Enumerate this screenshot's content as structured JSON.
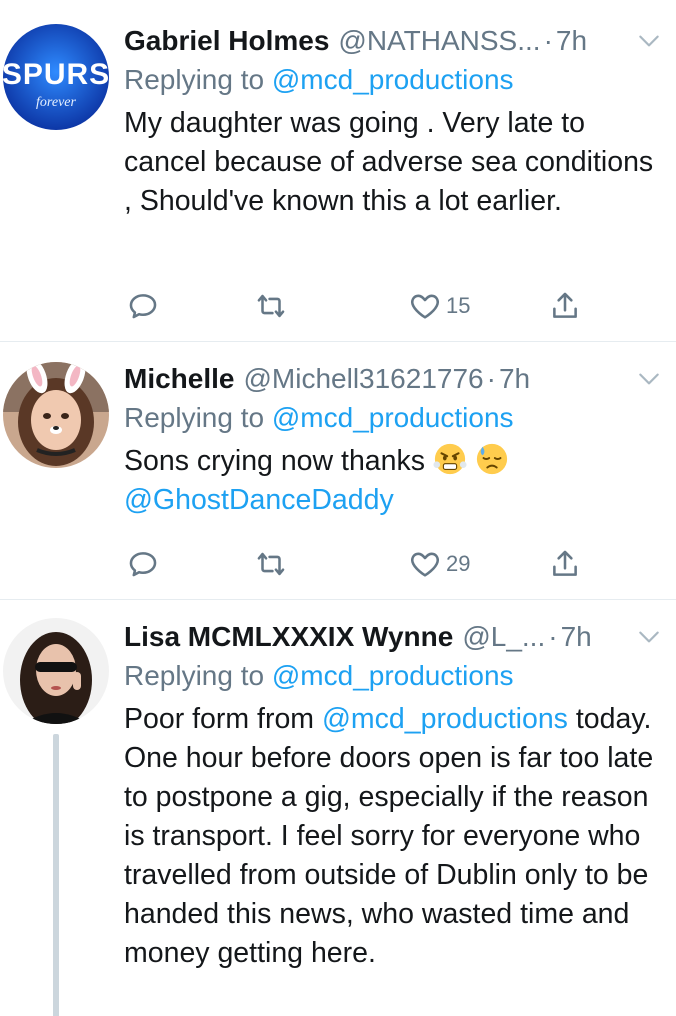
{
  "tweets": [
    {
      "name": "Gabriel Holmes",
      "handle": "@NATHANSS...",
      "time": "7h",
      "replying_prefix": "Replying to ",
      "replying_to": "@mcd_productions",
      "text": "My daughter was going . Very late to cancel because of adverse sea conditions , Should've known this a lot earlier.",
      "avatar_text": "SPURS",
      "avatar_subtext": "forever",
      "likes": "15"
    },
    {
      "name": "Michelle",
      "handle": "@Michell31621776",
      "time": "7h",
      "replying_prefix": "Replying to ",
      "replying_to": "@mcd_productions",
      "text": "Sons crying now thanks",
      "mention": "@GhostDanceDaddy",
      "likes": "29"
    },
    {
      "name": "Lisa MCMLXXXIX Wynne",
      "handle": "@L_...",
      "time": "7h",
      "replying_prefix": "Replying to ",
      "replying_to": "@mcd_productions",
      "text_prefix": "Poor form from ",
      "text_mention": "@mcd_productions",
      "text": " today. One hour before doors open is far too late to postpone a gig, especially if the reason is transport. I feel sorry for everyone who travelled from outside of Dublin only to be handed this news, who wasted time and money getting here."
    }
  ],
  "colors": {
    "accent": "#1da1f2",
    "secondary_text": "#657786",
    "divider": "#e6ecf0"
  },
  "icons": [
    "reply-icon",
    "retweet-icon",
    "like-icon",
    "share-icon",
    "chevron-down-icon",
    "angry-face-emoji",
    "sad-sweat-face-emoji"
  ]
}
